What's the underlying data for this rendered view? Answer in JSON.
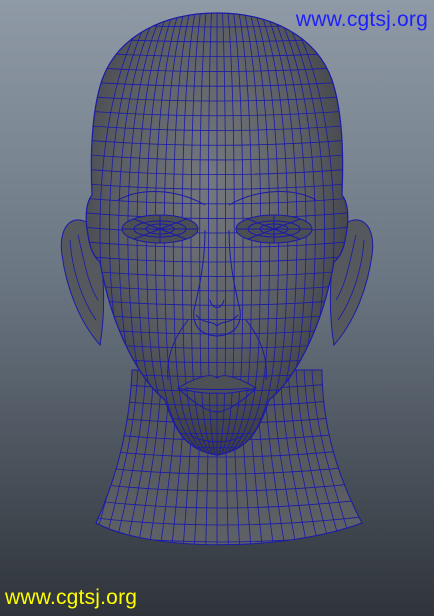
{
  "watermark_top": {
    "text": "www.cgtsj.org",
    "color": "#1e1eff"
  },
  "watermark_bottom": {
    "text": "www.cgtsj.org",
    "color": "#ffff00"
  },
  "model": {
    "subject": "head-wireframe-mesh",
    "wire_color": "#1a1aa8",
    "surface_color": "#5a5d62"
  }
}
